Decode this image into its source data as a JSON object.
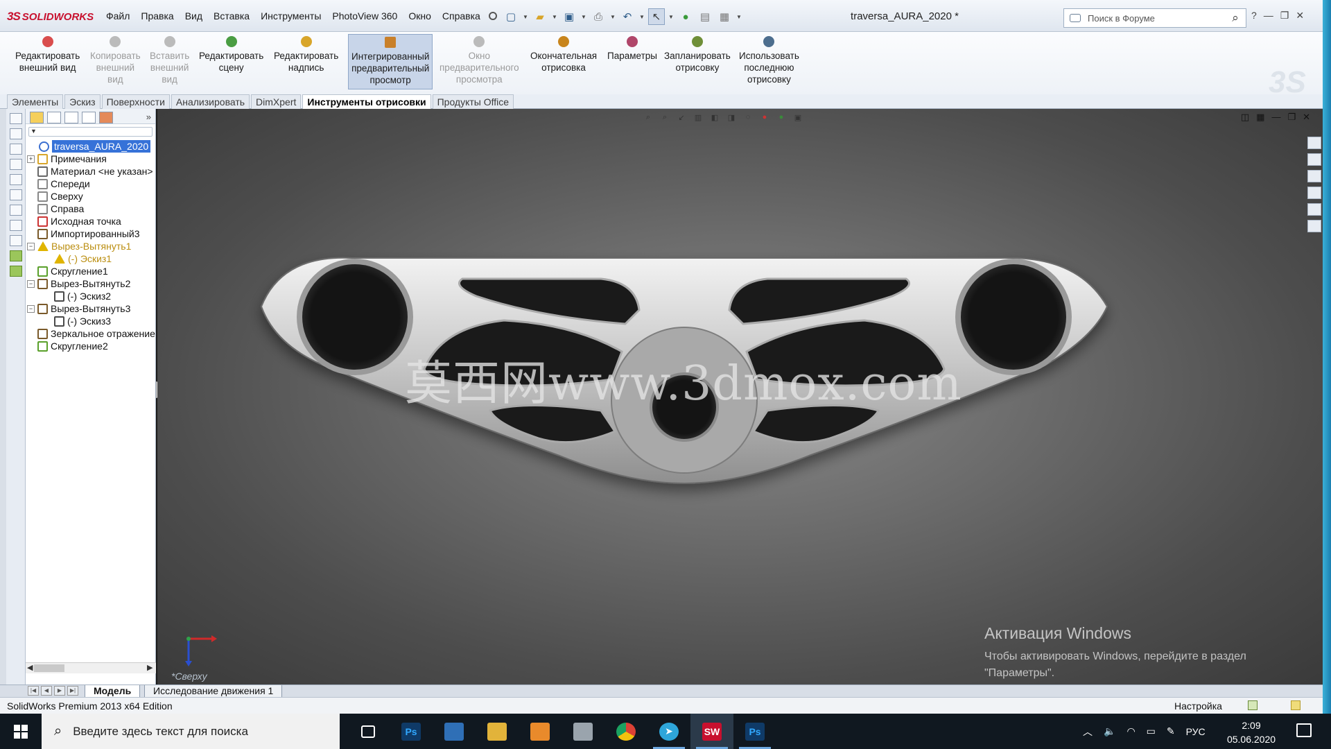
{
  "app": {
    "logo_text": "SOLIDWORKS",
    "document_title": "traversa_AURA_2020 *"
  },
  "menu": [
    "Файл",
    "Правка",
    "Вид",
    "Вставка",
    "Инструменты",
    "PhotoView 360",
    "Окно",
    "Справка"
  ],
  "search": {
    "placeholder": "Поиск в Форуме"
  },
  "commands": [
    {
      "label": "Редактировать\nвнешний вид",
      "icon": "edit-appearance-icon",
      "enabled": true,
      "color": "#d94d4d"
    },
    {
      "label": "Копировать\nвнешний\nвид",
      "icon": "copy-appearance-icon",
      "enabled": false,
      "color": "#bbbbbb"
    },
    {
      "label": "Вставить\nвнешний\nвид",
      "icon": "paste-appearance-icon",
      "enabled": false,
      "color": "#bbbbbb"
    },
    {
      "label": "Редактировать\nсцену",
      "icon": "edit-scene-icon",
      "enabled": true,
      "color": "#4a9d43"
    },
    {
      "label": "Редактировать\nнадпись",
      "icon": "edit-decal-icon",
      "enabled": true,
      "color": "#d8a52a"
    },
    {
      "label": "Интегрированный\nпредварительный\nпросмотр",
      "icon": "integrated-preview-icon",
      "enabled": true,
      "active": true,
      "color": "#c9802a"
    },
    {
      "label": "Окно\nпредварительного\nпросмотра",
      "icon": "preview-window-icon",
      "enabled": false,
      "color": "#bbbbbb"
    },
    {
      "label": "Окончательная\nотрисовка",
      "icon": "final-render-icon",
      "enabled": true,
      "color": "#c8851c"
    },
    {
      "label": "Параметры",
      "icon": "options-icon",
      "enabled": true,
      "color": "#b0466a"
    },
    {
      "label": "Запланировать\nотрисовку",
      "icon": "schedule-render-icon",
      "enabled": true,
      "color": "#6f8f38"
    },
    {
      "label": "Использовать\nпоследнюю\nотрисовку",
      "icon": "recall-last-render-icon",
      "enabled": true,
      "color": "#4d6e8e"
    }
  ],
  "tabs": [
    "Элементы",
    "Эскиз",
    "Поверхности",
    "Анализировать",
    "DimXpert",
    "Инструменты отрисовки",
    "Продукты Office"
  ],
  "active_tab": "Инструменты отрисовки",
  "tree": [
    {
      "label": "traversa_AURA_2020",
      "indent": 0,
      "toggle": "",
      "icon": "part-icon",
      "selected": true
    },
    {
      "label": "Примечания",
      "indent": 1,
      "toggle": "+",
      "icon": "annotations-icon"
    },
    {
      "label": "Материал <не указан>",
      "indent": 1,
      "toggle": "",
      "icon": "material-icon"
    },
    {
      "label": "Спереди",
      "indent": 1,
      "toggle": "",
      "icon": "plane-icon"
    },
    {
      "label": "Сверху",
      "indent": 1,
      "toggle": "",
      "icon": "plane-icon"
    },
    {
      "label": "Справа",
      "indent": 1,
      "toggle": "",
      "icon": "plane-icon"
    },
    {
      "label": "Исходная точка",
      "indent": 1,
      "toggle": "",
      "icon": "origin-icon"
    },
    {
      "label": "Импортированный3",
      "indent": 1,
      "toggle": "",
      "icon": "imported-body-icon"
    },
    {
      "label": "Вырез-Вытянуть1",
      "indent": 1,
      "toggle": "−",
      "icon": "warning-icon",
      "warning": true
    },
    {
      "label": "(-) Эскиз1",
      "indent": 2,
      "toggle": "",
      "icon": "warning-icon",
      "warning": true
    },
    {
      "label": "Скругление1",
      "indent": 1,
      "toggle": "",
      "icon": "fillet-icon"
    },
    {
      "label": "Вырез-Вытянуть2",
      "indent": 1,
      "toggle": "−",
      "icon": "cut-extrude-icon"
    },
    {
      "label": "(-) Эскиз2",
      "indent": 2,
      "toggle": "",
      "icon": "sketch-icon"
    },
    {
      "label": "Вырез-Вытянуть3",
      "indent": 1,
      "toggle": "−",
      "icon": "cut-extrude-icon"
    },
    {
      "label": "(-) Эскиз3",
      "indent": 2,
      "toggle": "",
      "icon": "sketch-icon"
    },
    {
      "label": "Зеркальное отражение",
      "indent": 1,
      "toggle": "",
      "icon": "mirror-icon"
    },
    {
      "label": "Скругление2",
      "indent": 1,
      "toggle": "",
      "icon": "fillet-icon"
    }
  ],
  "viewport": {
    "watermark": "莫西网www.3dmox.com",
    "view_name": "*Сверху",
    "activation_title": "Активация Windows",
    "activation_text": "Чтобы активировать Windows, перейдите в раздел \"Параметры\"."
  },
  "bottom_tabs": [
    "Модель",
    "Исследование движения 1"
  ],
  "status": {
    "left": "SolidWorks Premium 2013 x64 Edition",
    "customize": "Настройка"
  },
  "taskbar": {
    "search_placeholder": "Введите здесь текст для поиска",
    "apps": [
      {
        "name": "task-view",
        "label": "",
        "color": "#101820"
      },
      {
        "name": "photoshop",
        "label": "Ps",
        "color": "#0f3a67"
      },
      {
        "name": "store",
        "label": "",
        "color": "#2f6fb6"
      },
      {
        "name": "explorer",
        "label": "",
        "color": "#e2b33a"
      },
      {
        "name": "media-player",
        "label": "",
        "color": "#e98a2b"
      },
      {
        "name": "printer",
        "label": "",
        "color": "#9aa4ad"
      },
      {
        "name": "chrome",
        "label": "",
        "color": "#dc4135"
      },
      {
        "name": "telegram",
        "label": "",
        "color": "#2ea6da"
      },
      {
        "name": "solidworks",
        "label": "SW",
        "color": "#c8102e"
      },
      {
        "name": "photoshop-2",
        "label": "Ps",
        "color": "#0f3a67"
      }
    ],
    "language": "РУС",
    "time": "2:09",
    "date": "05.06.2020"
  }
}
